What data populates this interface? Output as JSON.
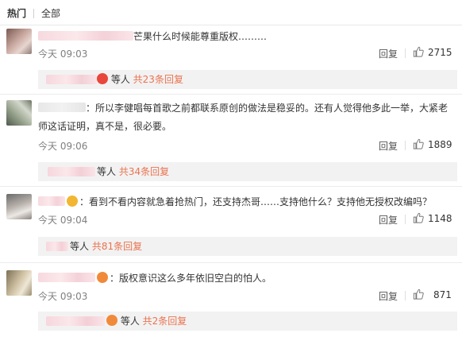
{
  "tabs": {
    "hot": "热门",
    "all": "全部"
  },
  "labels": {
    "reply": "回复",
    "others": "等人"
  },
  "comments": [
    {
      "text": "芒果什么时候能尊重版权………",
      "text2": "",
      "time": "今天 09:03",
      "likes": "2715",
      "sub_link": "共23条回复",
      "avatar_icon": "avatar-blurred"
    },
    {
      "text": "：所以李健唱每首歌之前都联系原创的做法是稳妥的。还有人觉得他多此一举，大紧老",
      "text2": "师这话证明，真不是，很必要。",
      "time": "今天 09:06",
      "likes": "1889",
      "sub_link": "共34条回复",
      "avatar_icon": "avatar-blurred"
    },
    {
      "text": "：看到不看内容就急着抢热门，还支持杰哥……支持他什么？支持他无授权改编吗？",
      "text2": "",
      "time": "今天 09:04",
      "likes": "1148",
      "sub_link": "共81条回复",
      "avatar_icon": "avatar-blurred"
    },
    {
      "text": "：版权意识这么多年依旧空白的怕人。",
      "text2": "",
      "time": "今天 09:03",
      "likes": "871",
      "sub_link": "共2条回复",
      "avatar_icon": "avatar-blurred"
    }
  ],
  "colors": {
    "link": "#eb7350",
    "time": "#808080",
    "subbox": "#f2f2f2"
  },
  "icons": {
    "like": "thumbs-up-icon",
    "badge_red": "red-star-badge-icon",
    "badge_gold": "gold-badge-icon"
  }
}
